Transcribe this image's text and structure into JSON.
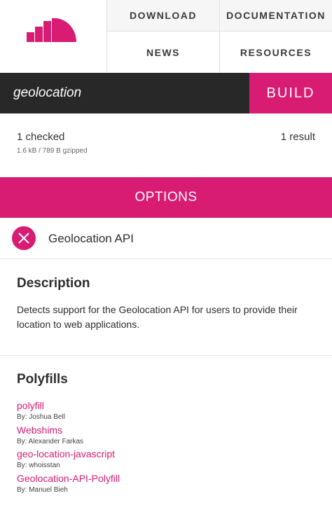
{
  "nav": {
    "download": "DOWNLOAD",
    "documentation": "DOCUMENTATION",
    "news": "NEWS",
    "resources": "RESOURCES"
  },
  "search": {
    "value": "geolocation",
    "build_label": "BUILD"
  },
  "status": {
    "checked": "1 checked",
    "size": "1.6 kB / 789 B gzipped",
    "results": "1 result"
  },
  "options_label": "OPTIONS",
  "feature": {
    "name": "Geolocation API"
  },
  "description": {
    "title": "Description",
    "text": "Detects support for the Geolocation API for users to provide their location to web applications."
  },
  "polyfills": {
    "title": "Polyfills",
    "items": [
      {
        "name": "polyfill",
        "author": "By: Joshua Bell"
      },
      {
        "name": "Webshims",
        "author": "By: Alexander Farkas"
      },
      {
        "name": "geo-location-javascript",
        "author": "By: whoisstan"
      },
      {
        "name": "Geolocation-API-Polyfill",
        "author": "By: Manuel Bieh"
      }
    ]
  },
  "colors": {
    "accent": "#d81b73",
    "dark": "#282828"
  }
}
